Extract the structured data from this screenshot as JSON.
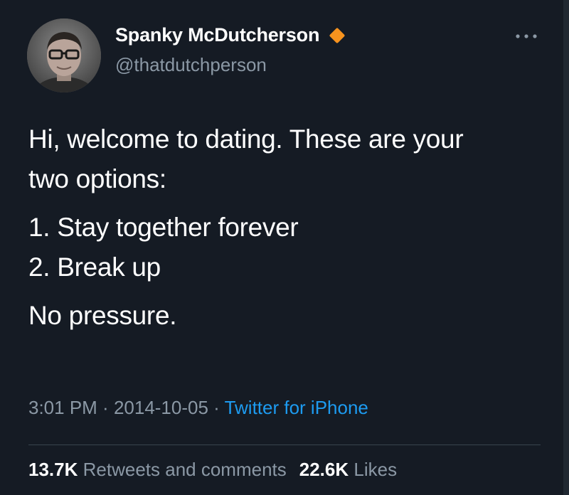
{
  "author": {
    "display_name": "Spanky McDutcherson",
    "handle": "@thatdutchperson",
    "badge_icon": "orange-diamond-icon",
    "badge_color": "#f7931e",
    "avatar_icon": "person-with-glasses-avatar"
  },
  "menu": {
    "icon": "more-options-icon"
  },
  "tweet": {
    "line1": "Hi, welcome to dating. These are your",
    "line2": "two options:",
    "option1": "1. Stay together forever",
    "option2": "2. Break up",
    "closing": "No pressure."
  },
  "meta": {
    "time": "3:01 PM",
    "separator1": " · ",
    "date": "2014-10-05",
    "separator2": " · ",
    "source": "Twitter for iPhone"
  },
  "stats": {
    "retweets_count": "13.7K",
    "retweets_label": "Retweets and comments",
    "likes_count": "22.6K",
    "likes_label": "Likes"
  },
  "colors": {
    "background": "#151b24",
    "text": "#ffffff",
    "secondary_text": "#8b98a5",
    "link": "#1d9bf0"
  }
}
